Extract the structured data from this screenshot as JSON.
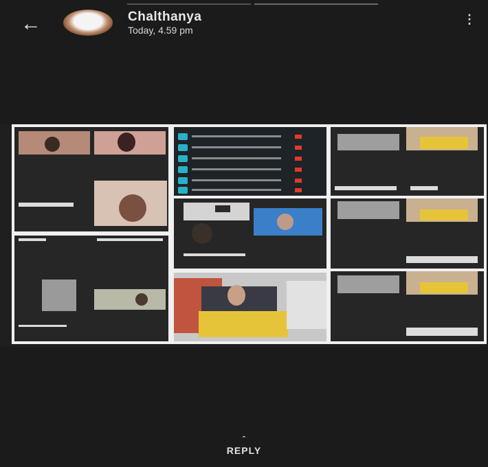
{
  "header": {
    "back_icon": "arrow-left-icon",
    "contact_name": "Chalthanya",
    "timestamp": "Today, 4.59 pm",
    "menu_icon": "more-vertical-icon"
  },
  "media": {
    "description_icon": "video-meeting-screenshot"
  },
  "footer": {
    "reply_label": "REPLY",
    "reply_icon": "chevron-up-icon"
  },
  "colors": {
    "background": "#1b1b1b",
    "text": "#e9e9e9",
    "accent_cyan": "#2ab0c8",
    "accent_red": "#e03a2a",
    "saree_yellow": "#e6c43a"
  }
}
